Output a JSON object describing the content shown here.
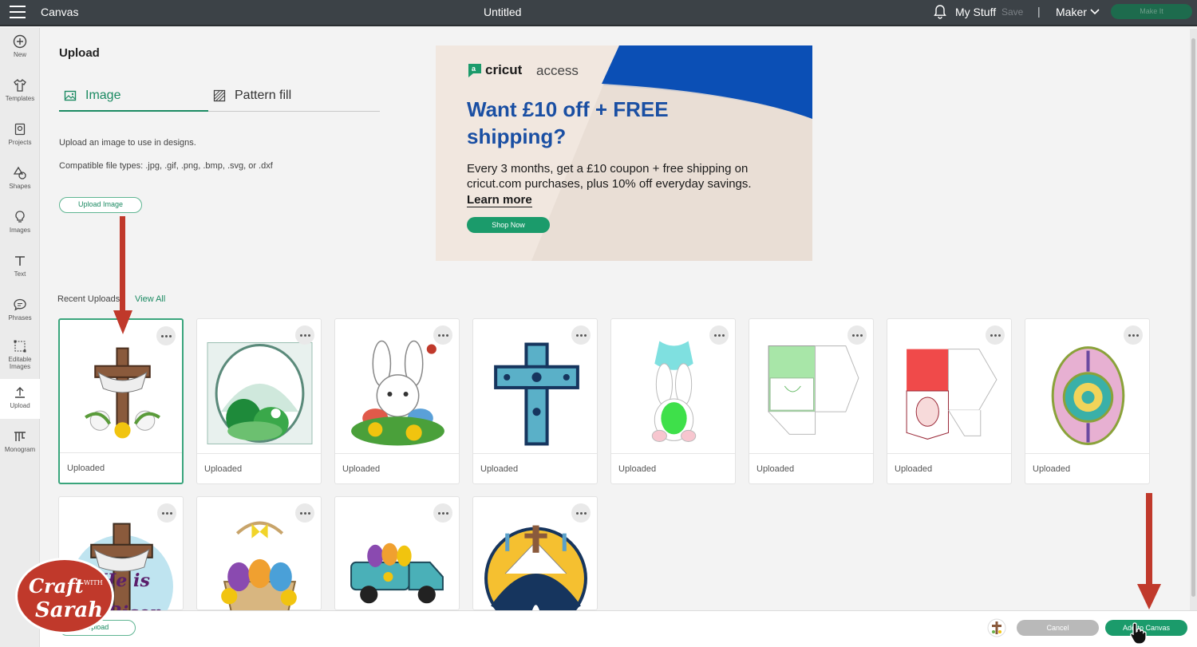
{
  "topbar": {
    "app_title": "Canvas",
    "doc_title": "Untitled",
    "my_stuff": "My Stuff",
    "save": "Save",
    "separator": "|",
    "machine": "Maker",
    "make_it": "Make It"
  },
  "sidebar": {
    "items": [
      {
        "label": "New",
        "icon": "plus-circle-icon"
      },
      {
        "label": "Templates",
        "icon": "shirt-icon"
      },
      {
        "label": "Projects",
        "icon": "projects-icon"
      },
      {
        "label": "Shapes",
        "icon": "shapes-icon"
      },
      {
        "label": "Images",
        "icon": "lightbulb-icon"
      },
      {
        "label": "Text",
        "icon": "text-icon"
      },
      {
        "label": "Phrases",
        "icon": "speech-bubble-icon"
      },
      {
        "label": "Editable Images",
        "icon": "editable-images-icon"
      },
      {
        "label": "Upload",
        "icon": "upload-icon"
      },
      {
        "label": "Monogram",
        "icon": "monogram-icon"
      }
    ]
  },
  "upload_panel": {
    "title": "Upload",
    "tabs": [
      {
        "label": "Image",
        "active": true
      },
      {
        "label": "Pattern fill",
        "active": false
      }
    ],
    "description": "Upload an image to use in designs.",
    "file_types": "Compatible file types: .jpg, .gif, .png, .bmp, .svg, or .dxf",
    "upload_button": "Upload Image"
  },
  "ad": {
    "brand": "cricut",
    "brand_sub": "access",
    "headline": "Want £10 off + FREE shipping?",
    "body": "Every 3 months, get a £10 coupon + free shipping on cricut.com purchases, plus 10% off everyday savings.",
    "learn_more": "Learn more",
    "shop_now": "Shop Now",
    "colors": {
      "background": "#f1e7df",
      "blue": "#1a4fa3",
      "button": "#1b9b6b"
    }
  },
  "recent": {
    "label": "Recent Uploads",
    "view_all": "View All",
    "uploads": [
      {
        "caption": "Uploaded",
        "art": "easter-cross-with-lilies",
        "selected": true
      },
      {
        "caption": "Uploaded",
        "art": "bunny-scene-egg-frame",
        "selected": false
      },
      {
        "caption": "Uploaded",
        "art": "bunny-with-flowers",
        "selected": false
      },
      {
        "caption": "Uploaded",
        "art": "mandala-cross",
        "selected": false
      },
      {
        "caption": "Uploaded",
        "art": "bunny-body-outline",
        "selected": false
      },
      {
        "caption": "Uploaded",
        "art": "green-envelope-template",
        "selected": false
      },
      {
        "caption": "Uploaded",
        "art": "red-envelope-template",
        "selected": false
      },
      {
        "caption": "Uploaded",
        "art": "mandala-easter-egg",
        "selected": false
      },
      {
        "caption": "",
        "art": "he-is-risen-cross",
        "selected": false
      },
      {
        "caption": "",
        "art": "easter-basket",
        "selected": false
      },
      {
        "caption": "",
        "art": "easter-truck",
        "selected": false
      },
      {
        "caption": "",
        "art": "empty-tomb-circle",
        "selected": false
      }
    ]
  },
  "bottom": {
    "upload": "Upload",
    "cancel": "Cancel",
    "add_to_canvas": "Add to Canvas"
  },
  "watermark": {
    "line1": "Craft",
    "with": "WITH",
    "line2": "Sarah"
  },
  "colors": {
    "accent": "#1b8a62",
    "annotation_arrow": "#c0392b"
  }
}
